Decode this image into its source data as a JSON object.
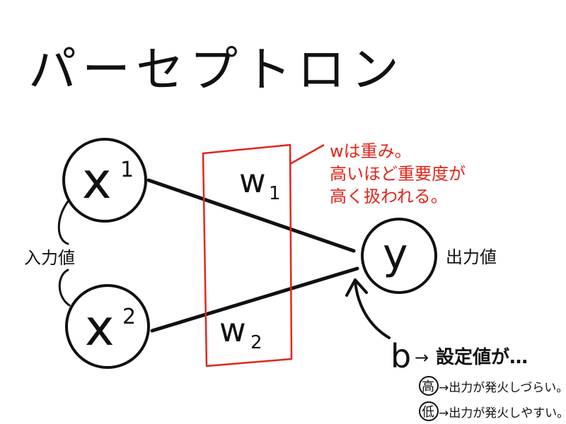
{
  "title": "パーセプトロン",
  "nodes": {
    "x1": {
      "base": "x",
      "sup": "1"
    },
    "x2": {
      "base": "x",
      "sup": "2"
    },
    "y": {
      "label": "y"
    }
  },
  "weights": {
    "w1": {
      "base": "w",
      "sub": "1"
    },
    "w2": {
      "base": "w",
      "sub": "2"
    }
  },
  "labels": {
    "input": "入力値",
    "output": "出力値"
  },
  "note": {
    "lines": [
      "wは重み。",
      "高いほど重要度が",
      "高く扱われる。"
    ],
    "color": "#e2261b"
  },
  "bias": {
    "symbol": "b",
    "arrow": "→",
    "heading": "設定値が…",
    "high": {
      "mark": "高",
      "text": "→出力が発火しづらい。"
    },
    "low": {
      "mark": "低",
      "text": "→出力が発火しやすい。"
    }
  },
  "colors": {
    "ink": "#111111",
    "accent": "#e2261b",
    "background": "#ffffff"
  }
}
